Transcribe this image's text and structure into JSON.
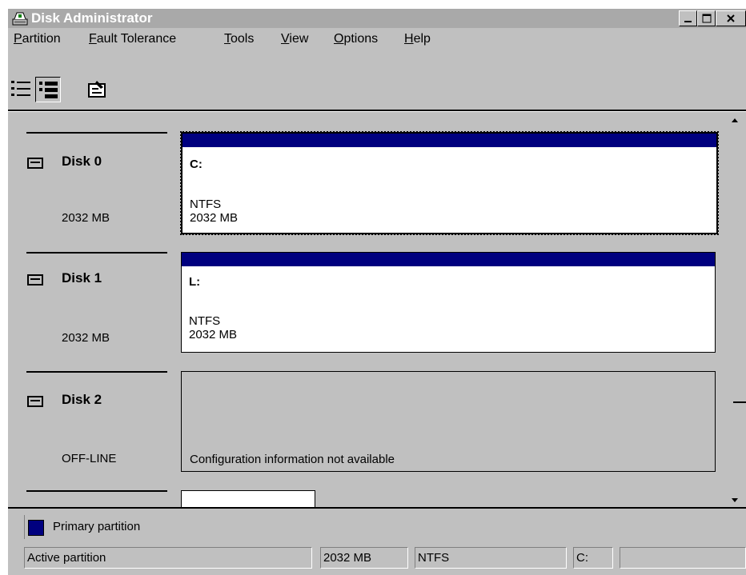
{
  "window": {
    "title": "Disk Administrator",
    "title_icon": "disk-administrator-app-icon",
    "controls": {
      "minimize": "minimize-icon",
      "maximize": "maximize-icon",
      "close": "close-icon"
    }
  },
  "menu": [
    {
      "label": "Partition",
      "accel": "P",
      "rest": "artition"
    },
    {
      "label": "Fault Tolerance",
      "accel": "F",
      "rest": "ault Tolerance"
    },
    {
      "label": "Tools",
      "accel": "T",
      "rest": "ools"
    },
    {
      "label": "View",
      "accel": "V",
      "rest": "iew"
    },
    {
      "label": "Options",
      "accel": "O",
      "rest": "ptions"
    },
    {
      "label": "Help",
      "accel": "H",
      "rest": "elp"
    }
  ],
  "toolbar": {
    "buttons": [
      {
        "name": "volumes-view",
        "icon": "list-view-icon"
      },
      {
        "name": "disk-configuration-view",
        "icon": "disk-view-icon"
      },
      {
        "name": "properties",
        "icon": "properties-icon"
      }
    ]
  },
  "disks": [
    {
      "name": "Disk 0",
      "size": "2032 MB",
      "partition": {
        "letter": "C:",
        "fs": "NTFS",
        "size": "2032 MB"
      }
    },
    {
      "name": "Disk 1",
      "size": "2032 MB",
      "partition": {
        "letter": "L:",
        "fs": "NTFS",
        "size": "2032 MB"
      }
    },
    {
      "name": "Disk 2",
      "size": "OFF-LINE",
      "message": "Configuration information not available"
    }
  ],
  "legend": {
    "label": "Primary partition",
    "color": "#00007f"
  },
  "statusbar": {
    "status": "Active partition",
    "size": "2032 MB",
    "fs": "NTFS",
    "drive": "C:",
    "extra": ""
  },
  "colors": {
    "window_bg": "#c0c0c0",
    "titlebar_inactive": "#a9a9a9",
    "partition_header": "#00007f"
  }
}
